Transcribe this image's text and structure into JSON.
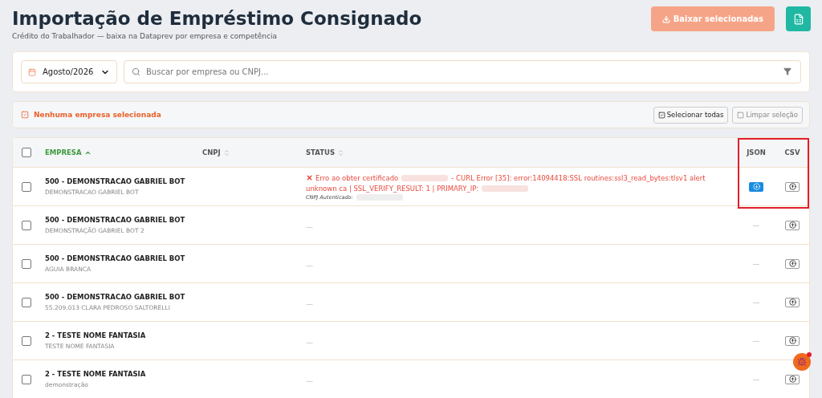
{
  "header": {
    "title": "Importação de Empréstimo Consignado",
    "subtitle": "Crédito do Trabalhador — baixa na Dataprev por empresa e competência",
    "download_button": {
      "label": "Baixar selecionadas",
      "disabled": true
    }
  },
  "filters": {
    "period": "Agosto/2026",
    "search": {
      "placeholder": "Buscar por empresa ou CNPJ..."
    }
  },
  "selection_bar": {
    "message": "Nenhuma empresa selecionada",
    "select_all": "Selecionar todas",
    "clear": "Limpar seleção"
  },
  "table": {
    "select_all_checked": false,
    "columns": [
      {
        "label": "EMPRESA",
        "sortable": true,
        "sorted": true
      },
      {
        "label": "CNPJ",
        "sortable": true,
        "sorted": false
      },
      {
        "label": "STATUS",
        "sortable": true,
        "sorted": false
      },
      {
        "label": "JSON",
        "sortable": false,
        "sorted": false
      },
      {
        "label": "CSV",
        "sortable": false,
        "sorted": false
      }
    ],
    "rows": [
      {
        "checked": false,
        "name": "500 - DEMONSTRACAO GABRIEL BOT",
        "trade_name": "DEMONSTRACAO GABRIEL BOT",
        "status": {
          "kind": "error",
          "message_start": "Erro ao obter certificado",
          "message_end": "- CURL Error [35]: error:14094418:SSL routines:ssl3_read_bytes:tlsv1 alert unknown ca | SSL_VERIFY_RESULT: 1 | PRIMARY_IP:",
          "detail_label": "CNPJ Autenticado:"
        },
        "json": {
          "kind": "button"
        },
        "csv": {
          "kind": "button"
        }
      },
      {
        "checked": false,
        "name": "500 - DEMONSTRACAO GABRIEL BOT",
        "trade_name": "DEMONSTRAÇÃO GABRIEL BOT 2",
        "status": {
          "kind": "empty",
          "text": "—"
        },
        "json": {
          "kind": "empty",
          "text": "—"
        },
        "csv": {
          "kind": "button"
        }
      },
      {
        "checked": false,
        "name": "500 - DEMONSTRACAO GABRIEL BOT",
        "trade_name": "AGUIA BRANCA",
        "status": {
          "kind": "empty",
          "text": "—"
        },
        "json": {
          "kind": "empty",
          "text": "—"
        },
        "csv": {
          "kind": "button"
        }
      },
      {
        "checked": false,
        "name": "500 - DEMONSTRACAO GABRIEL BOT",
        "trade_name": "55.209.013 CLARA PEDROSO SALTORELLI",
        "status": {
          "kind": "empty",
          "text": "—"
        },
        "json": {
          "kind": "empty",
          "text": "—"
        },
        "csv": {
          "kind": "button"
        }
      },
      {
        "checked": false,
        "name": "2 - TESTE NOME FANTASIA",
        "trade_name": "TESTE NOME FANTASIA",
        "status": {
          "kind": "empty",
          "text": "—"
        },
        "json": {
          "kind": "empty",
          "text": "—"
        },
        "csv": {
          "kind": "button"
        }
      },
      {
        "checked": false,
        "name": "2 - TESTE NOME FANTASIA",
        "trade_name": "demonstração",
        "status": {
          "kind": "empty",
          "text": "—"
        },
        "json": {
          "kind": "empty",
          "text": "—"
        },
        "csv": {
          "kind": "button"
        }
      }
    ]
  }
}
